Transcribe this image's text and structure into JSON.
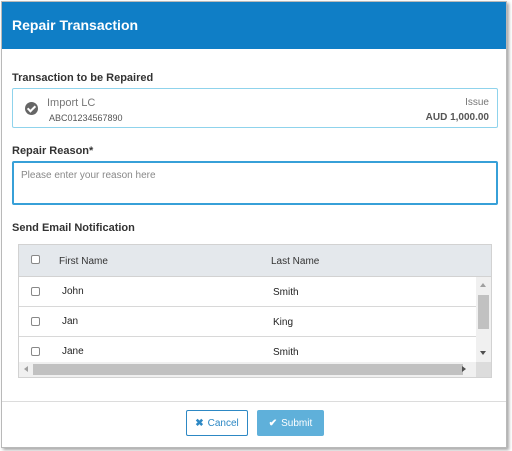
{
  "dialog": {
    "title": "Repair Transaction"
  },
  "transaction": {
    "section_label": "Transaction to be Repaired",
    "icon": "check-circle-icon",
    "type": "Import LC",
    "reference": "ABC01234567890",
    "action": "Issue",
    "amount": "AUD 1,000.00"
  },
  "repair_reason": {
    "label": "Repair Reason*",
    "value": "",
    "placeholder": "Please enter your reason here"
  },
  "email": {
    "section_label": "Send Email Notification",
    "columns": {
      "first_name": "First Name",
      "last_name": "Last Name"
    },
    "rows": [
      {
        "first_name": "John",
        "last_name": "Smith",
        "checked": false
      },
      {
        "first_name": "Jan",
        "last_name": "King",
        "checked": false
      },
      {
        "first_name": "Jane",
        "last_name": "Smith",
        "checked": false
      }
    ]
  },
  "buttons": {
    "cancel_label": "Cancel",
    "cancel_icon": "✖",
    "submit_label": "Submit",
    "submit_icon": "✔"
  },
  "colors": {
    "header": "#0f7ec6",
    "accent_border": "#37a0d8",
    "submit_bg": "#5fb0da"
  }
}
